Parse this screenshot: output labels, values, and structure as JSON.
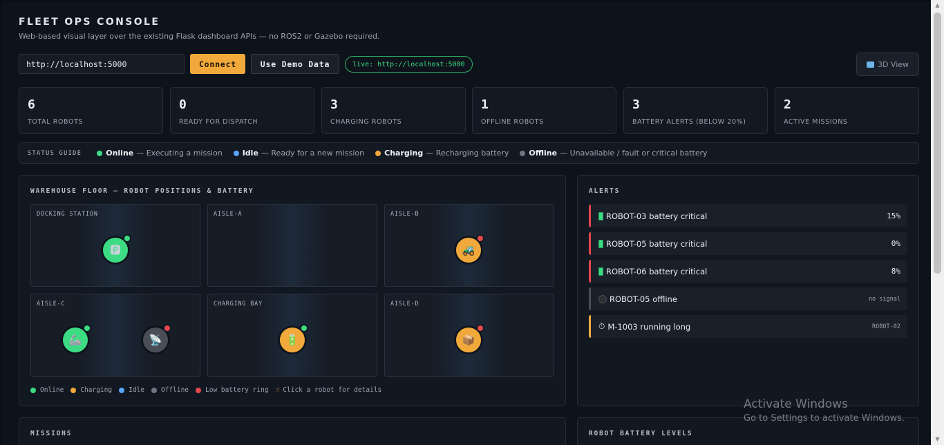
{
  "header": {
    "title": "FLEET OPS CONSOLE",
    "subtitle": "Web-based visual layer over the existing Flask dashboard APIs — no ROS2 or Gazebo required."
  },
  "toolbar": {
    "url_value": "http://localhost:5000",
    "connect_label": "Connect",
    "demo_label": "Use Demo Data",
    "live_label": "live: http://localhost:5000",
    "view3d_label": "3D View",
    "view3d_icon": "cube-icon"
  },
  "stats": [
    {
      "value": "6",
      "label": "TOTAL ROBOTS"
    },
    {
      "value": "0",
      "label": "READY FOR DISPATCH"
    },
    {
      "value": "3",
      "label": "CHARGING ROBOTS"
    },
    {
      "value": "1",
      "label": "OFFLINE ROBOTS"
    },
    {
      "value": "3",
      "label": "BATTERY ALERTS (BELOW 20%)"
    },
    {
      "value": "2",
      "label": "ACTIVE MISSIONS"
    }
  ],
  "status_guide": {
    "title": "STATUS GUIDE",
    "items": [
      {
        "name": "Online",
        "desc": "— Executing a mission",
        "color": "#3ddc84"
      },
      {
        "name": "Idle",
        "desc": "— Ready for a new mission",
        "color": "#58a6ff"
      },
      {
        "name": "Charging",
        "desc": "— Recharging battery",
        "color": "#f2a93b"
      },
      {
        "name": "Offline",
        "desc": "— Unavailable / fault or critical battery",
        "color": "#6e7681"
      }
    ]
  },
  "floor": {
    "title": "WAREHOUSE FLOOR — ROBOT POSITIONS & BATTERY",
    "zones": [
      {
        "label": "DOCKING STATION"
      },
      {
        "label": "AISLE-A"
      },
      {
        "label": "AISLE-B"
      },
      {
        "label": "AISLE-C"
      },
      {
        "label": "CHARGING BAY"
      },
      {
        "label": "AISLE-D"
      }
    ],
    "robots": [
      {
        "icon": "parking-icon",
        "glyph": "🅿",
        "color": "#3ddc84",
        "ring": "#3ddc84"
      },
      {
        "icon": "tractor-icon",
        "glyph": "🚜",
        "color": "#f2a93b",
        "ring": "#e5484d"
      },
      {
        "icon": "robot-arm-icon",
        "glyph": "🦾",
        "color": "#3ddc84",
        "ring": "#3ddc84"
      },
      {
        "icon": "satellite-dish-icon",
        "glyph": "📡",
        "color": "#4a4f57",
        "ring": "#e5484d"
      },
      {
        "icon": "battery-icon",
        "glyph": "🔋",
        "color": "#f2a93b",
        "ring": "#3ddc84"
      },
      {
        "icon": "package-icon",
        "glyph": "📦",
        "color": "#f2a93b",
        "ring": "#e5484d"
      }
    ],
    "legend": [
      {
        "label": "Online",
        "color": "#3ddc84"
      },
      {
        "label": "Charging",
        "color": "#f2a93b"
      },
      {
        "label": "Idle",
        "color": "#58a6ff"
      },
      {
        "label": "Offline",
        "color": "#6e7681"
      },
      {
        "label": "Low battery ring",
        "color": "#e5484d"
      }
    ],
    "hint": "Click a robot for details",
    "hint_icon": "pointer-icon"
  },
  "alerts": {
    "title": "ALERTS",
    "items": [
      {
        "text": "ROBOT-03 battery critical",
        "meta": "15%",
        "icon": "battery-icon",
        "color": "#e5484d"
      },
      {
        "text": "ROBOT-05 battery critical",
        "meta": "0%",
        "icon": "battery-icon",
        "color": "#e5484d"
      },
      {
        "text": "ROBOT-06 battery critical",
        "meta": "8%",
        "icon": "battery-icon",
        "color": "#e5484d"
      },
      {
        "text": "ROBOT-05 offline",
        "meta": "no signal",
        "icon": "offline-icon",
        "color": "#4a4f57"
      },
      {
        "text": "M-1003 running long",
        "meta": "ROBOT-02",
        "icon": "timer-icon",
        "color": "#f2a93b"
      }
    ]
  },
  "missions": {
    "title": "MISSIONS"
  },
  "battery_levels": {
    "title": "ROBOT BATTERY LEVELS"
  },
  "watermark": {
    "line1": "Activate Windows",
    "line2": "Go to Settings to activate Windows."
  }
}
